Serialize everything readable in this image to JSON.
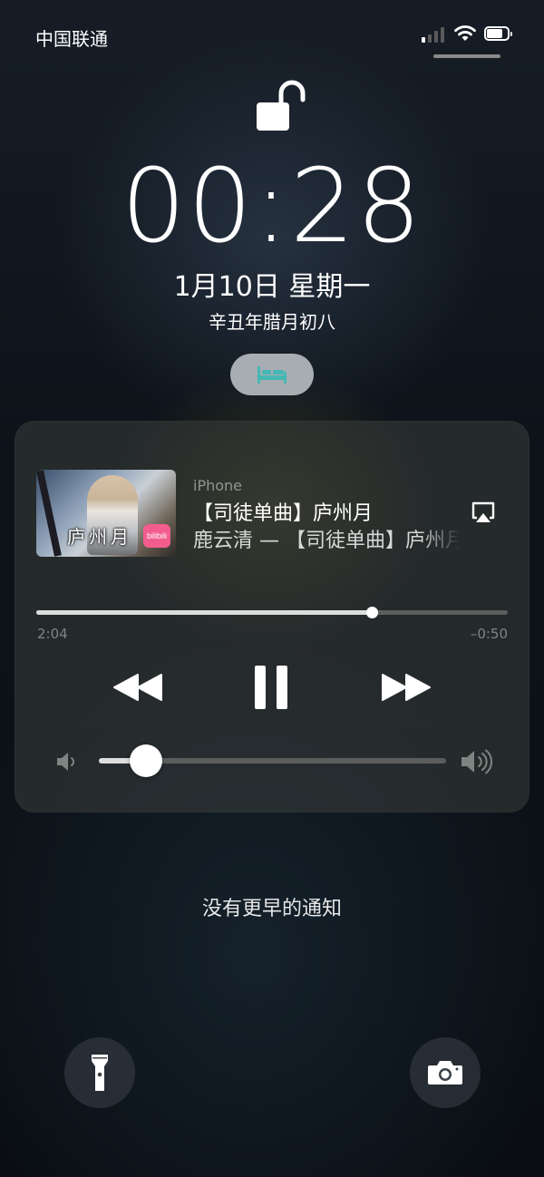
{
  "status_bar": {
    "carrier": "中国联通",
    "signal_icon": "cellular-signal-icon",
    "wifi_icon": "wifi-icon",
    "battery_icon": "battery-icon"
  },
  "lock_screen": {
    "lock_icon": "unlocked-padlock-icon",
    "time": "00:28",
    "date": "1月10日 星期一",
    "lunar_date": "辛丑年腊月初八",
    "sleep_icon": "bed-icon",
    "sleep_pill_color": "#c8cdd2",
    "sleep_icon_color": "#45b7b4"
  },
  "now_playing": {
    "source": "iPhone",
    "title": "【司徒单曲】庐州月",
    "artist_line": "鹿云清 — 【司徒单曲】庐州月",
    "artwork": {
      "overlay_text": "庐州月",
      "badge_text": "bilibili"
    },
    "airplay_icon": "airplay-icon",
    "elapsed": "2:04",
    "remaining": "–0:50",
    "progress_fraction": 0.712,
    "controls": {
      "rewind_icon": "rewind-icon",
      "pause_icon": "pause-icon",
      "forward_icon": "fast-forward-icon"
    },
    "volume_low_icon": "speaker-low-icon",
    "volume_high_icon": "speaker-high-icon",
    "volume_fraction": 0.135
  },
  "notifications": {
    "empty_text": "没有更早的通知"
  },
  "quick_actions": {
    "flashlight_icon": "flashlight-icon",
    "camera_icon": "camera-icon"
  }
}
